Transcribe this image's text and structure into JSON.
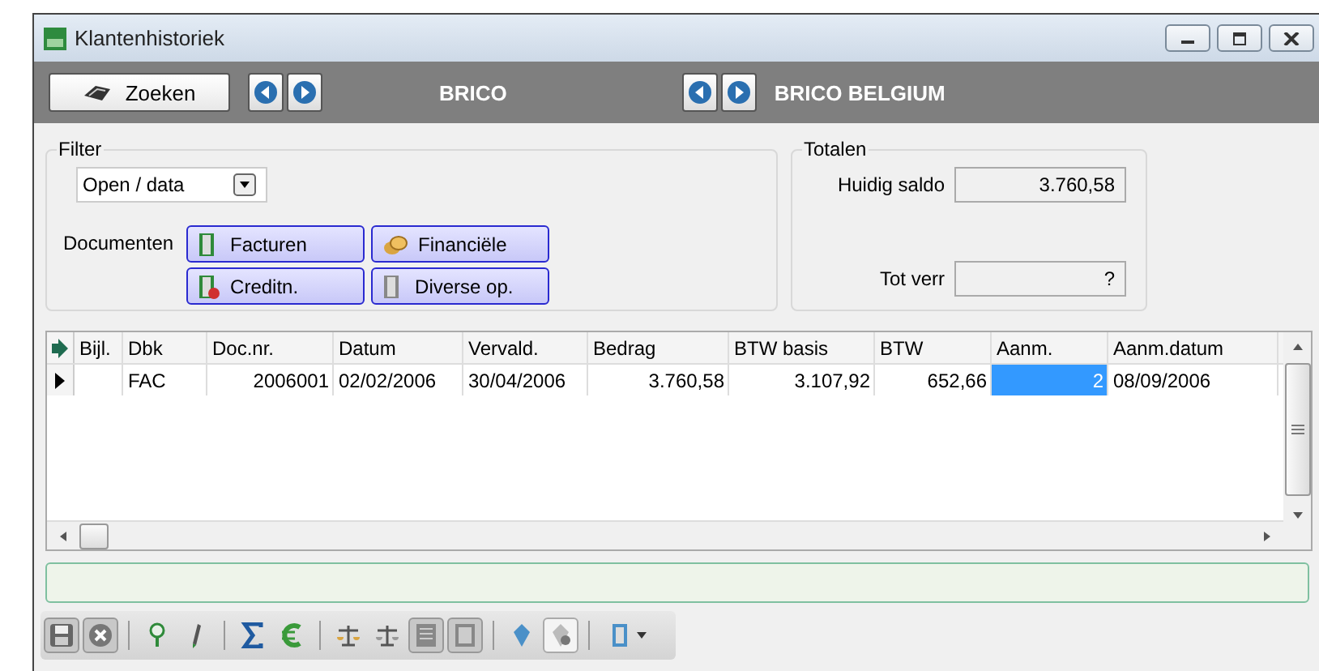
{
  "window": {
    "title": "Klantenhistoriek"
  },
  "header": {
    "search_button": "Zoeken",
    "left_name": "BRICO",
    "right_name": "BRICO BELGIUM"
  },
  "filter": {
    "title": "Filter",
    "dropdown": {
      "value": "Open / data"
    },
    "documents_label": "Documenten",
    "buttons": [
      {
        "label": "Facturen",
        "kind": "invoice"
      },
      {
        "label": "Financiële",
        "kind": "coins"
      },
      {
        "label": "Creditn.",
        "kind": "credit"
      },
      {
        "label": "Diverse op.",
        "kind": "misc"
      }
    ]
  },
  "totals": {
    "title": "Totalen",
    "fields": [
      {
        "label": "Huidig saldo",
        "value": "3.760,58"
      },
      {
        "label": "Tot verr",
        "value": "?"
      }
    ]
  },
  "table": {
    "columns": [
      {
        "label": "Bijl.",
        "kind": "text"
      },
      {
        "label": "Dbk",
        "kind": "text"
      },
      {
        "label": "Doc.nr.",
        "kind": "number"
      },
      {
        "label": "Datum",
        "kind": "text"
      },
      {
        "label": "Vervald.",
        "kind": "text"
      },
      {
        "label": "Bedrag",
        "kind": "number"
      },
      {
        "label": "BTW basis",
        "kind": "number"
      },
      {
        "label": "BTW",
        "kind": "number"
      },
      {
        "label": "Aanm.",
        "kind": "number"
      },
      {
        "label": "Aanm.datum",
        "kind": "text"
      }
    ],
    "rows": [
      {
        "current": true,
        "cells": [
          {
            "selected": false
          },
          {
            "text": "FAC",
            "selected": false
          },
          {
            "text": "2006001",
            "selected": false
          },
          {
            "text": "02/02/2006",
            "selected": false
          },
          {
            "text": "30/04/2006",
            "selected": false
          },
          {
            "text": "3.760,58",
            "selected": false
          },
          {
            "text": "3.107,92",
            "selected": false
          },
          {
            "text": "652,66",
            "selected": false
          },
          {
            "text": "2",
            "selected": true
          },
          {
            "text": "08/09/2006",
            "selected": false
          }
        ]
      }
    ]
  }
}
